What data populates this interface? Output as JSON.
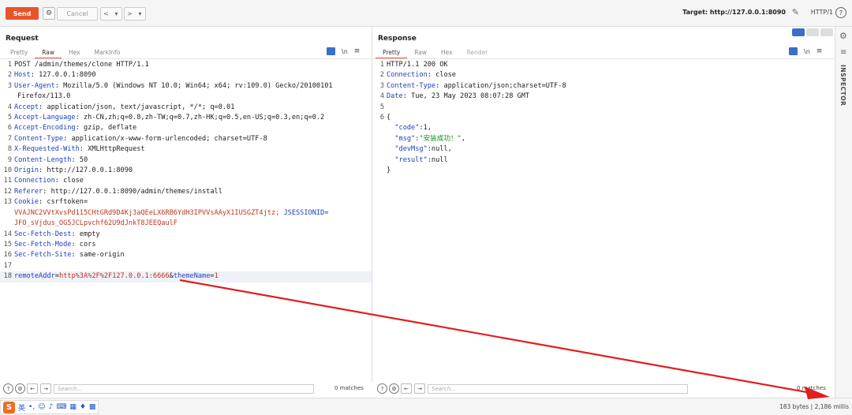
{
  "toolbar": {
    "send_label": "Send",
    "cancel_label": "Cancel",
    "back_label": "<",
    "back_dropdown": "▾",
    "forward_label": ">",
    "forward_dropdown": "▾",
    "target": "Target: http://127.0.0.1:8090",
    "protocol": "HTTP/1",
    "help": "?"
  },
  "request": {
    "title": "Request",
    "tabs": [
      "Pretty",
      "Raw",
      "Hex",
      "MarkInfo"
    ],
    "active_tab": "Raw",
    "newline_toggle": "\\n",
    "lines": [
      {
        "n": "1",
        "text": "POST /admin/themes/clone HTTP/1.1"
      },
      {
        "n": "2",
        "key": "Host",
        "val": " 127.0.0.1:8090"
      },
      {
        "n": "3",
        "key": "User-Agent",
        "val": " Mozilla/5.0 (Windows NT 10.0; Win64; x64; rv:109.0) Gecko/20100101"
      },
      {
        "n": "",
        "cont": "Firefox/113.0"
      },
      {
        "n": "4",
        "key": "Accept",
        "val": " application/json, text/javascript, */*; q=0.01"
      },
      {
        "n": "5",
        "key": "Accept-Language",
        "val": " zh-CN,zh;q=0.8,zh-TW;q=0.7,zh-HK;q=0.5,en-US;q=0.3,en;q=0.2"
      },
      {
        "n": "6",
        "key": "Accept-Encoding",
        "val": " gzip, deflate"
      },
      {
        "n": "7",
        "key": "Content-Type",
        "val": " application/x-www-form-urlencoded; charset=UTF-8"
      },
      {
        "n": "8",
        "key": "X-Requested-With",
        "val": " XMLHttpRequest"
      },
      {
        "n": "9",
        "key": "Content-Length",
        "val": " 50"
      },
      {
        "n": "10",
        "key": "Origin",
        "val": " http://127.0.0.1:8090"
      },
      {
        "n": "11",
        "key": "Connection",
        "val": " close"
      },
      {
        "n": "12",
        "key": "Referer",
        "val": " http://127.0.0.1:8090/admin/themes/install"
      },
      {
        "n": "13",
        "key": "Cookie",
        "val": " csrftoken="
      },
      {
        "n": "",
        "cookie": "VVAJNC2VVtXvsPd115CHtGRd9D4Kj3aQEeLX6RB6YdH3IPVVsAAyX1IUSGZT4jtz; ",
        "cookiekey": "JSESSIONID="
      },
      {
        "n": "",
        "cookie": "JFO_sVjdus_OG5JCLpvchf62U9dJnkT8JEEQaulF"
      },
      {
        "n": "14",
        "key": "Sec-Fetch-Dest",
        "val": " empty"
      },
      {
        "n": "15",
        "key": "Sec-Fetch-Mode",
        "val": " cors"
      },
      {
        "n": "16",
        "key": "Sec-Fetch-Site",
        "val": " same-origin"
      },
      {
        "n": "17",
        "text": ""
      },
      {
        "n": "18",
        "body": true
      }
    ],
    "body": {
      "k1": "remoteAddr",
      "eq1": "=",
      "v1": "http%3A%2F%2F127.0.0.1:6666",
      "amp": "&",
      "k2": "themeName",
      "eq2": "=",
      "v2": "1"
    },
    "search_placeholder": "Search...",
    "matches": "0 matches"
  },
  "response": {
    "title": "Response",
    "tabs": [
      "Pretty",
      "Raw",
      "Hex",
      "Render"
    ],
    "active_tab": "Pretty",
    "newline_toggle": "\\n",
    "lines": [
      {
        "n": "1",
        "text": "HTTP/1.1 200 OK"
      },
      {
        "n": "2",
        "key": "Connection",
        "val": " close"
      },
      {
        "n": "3",
        "key": "Content-Type",
        "val": " application/json;charset=UTF-8"
      },
      {
        "n": "4",
        "key": "Date",
        "val": " Tue, 23 May 2023 08:07:28 GMT"
      },
      {
        "n": "5",
        "text": ""
      },
      {
        "n": "6",
        "text": "{"
      },
      {
        "n": "",
        "json": [
          "  \"code\"",
          ":1,"
        ]
      },
      {
        "n": "",
        "jsonstr": [
          "  \"msg\"",
          ":",
          "\"安装成功！\"",
          ","
        ]
      },
      {
        "n": "",
        "json": [
          "  \"devMsg\"",
          ":null,"
        ]
      },
      {
        "n": "",
        "json": [
          "  \"result\"",
          ":null"
        ]
      },
      {
        "n": "",
        "text": "}"
      }
    ],
    "search_placeholder": "Search...",
    "matches": "0 matches"
  },
  "sidebar": {
    "inspector_label": "INSPECTOR"
  },
  "status": {
    "ime_logo": "S",
    "ime_mode": "英",
    "summary": "183 bytes | 2,186 millis"
  },
  "colors": {
    "accent": "#e8542b",
    "header_key": "#1f3fb8",
    "cookie_value": "#c2341f",
    "json_string": "#1a8a1a",
    "arrow": "#e01e1e"
  }
}
